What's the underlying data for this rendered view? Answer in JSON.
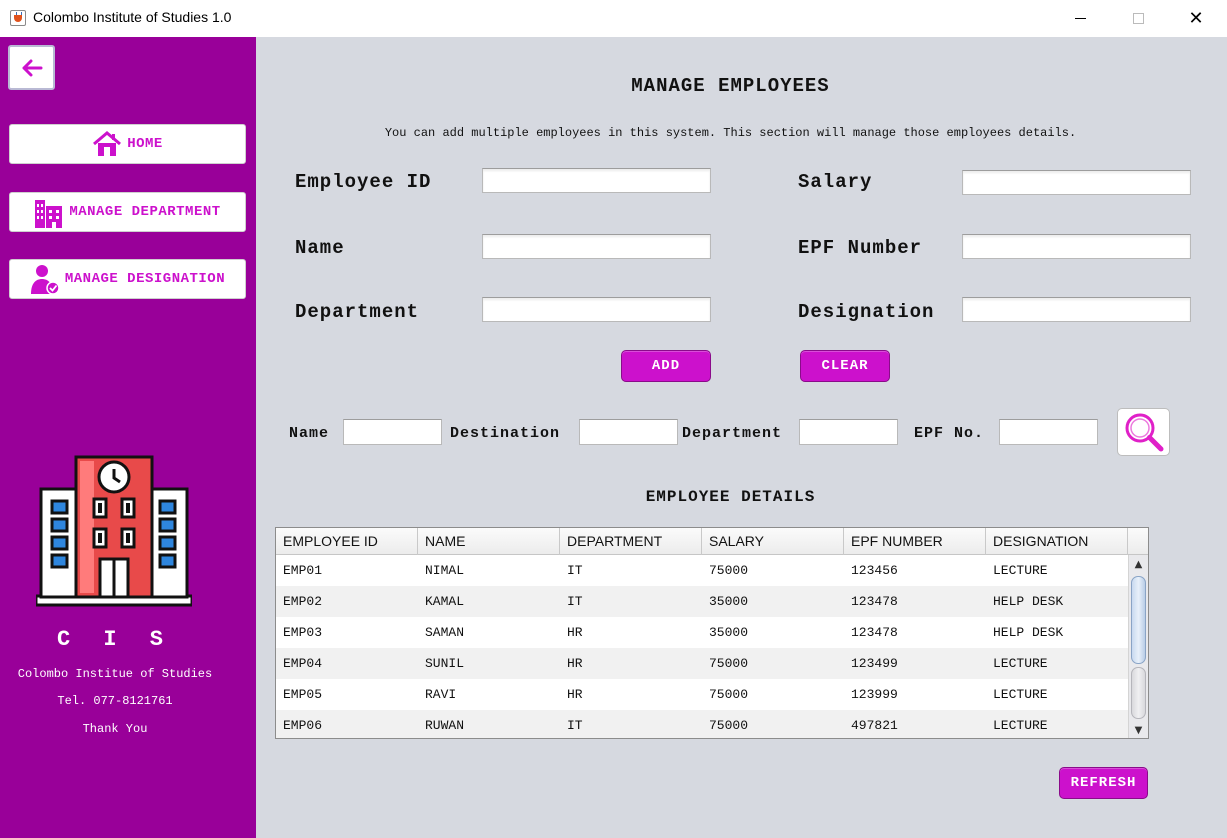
{
  "window": {
    "title": "Colombo Institute of Studies 1.0"
  },
  "sidebar": {
    "nav": [
      {
        "label": "HOME",
        "icon": "home-icon"
      },
      {
        "label": "MANAGE DEPARTMENT",
        "icon": "building-icon"
      },
      {
        "label": "MANAGE DESIGNATION",
        "icon": "user-check-icon"
      }
    ],
    "brand": {
      "abbr": "C I S",
      "name": "Colombo Institue of Studies",
      "tel": "Tel. 077-8121761",
      "thanks": "Thank You"
    }
  },
  "main": {
    "title": "MANAGE EMPLOYEES",
    "subtitle": "You can add multiple employees in this system. This section will manage those employees details.",
    "form": {
      "employee_id_label": "Employee ID",
      "name_label": "Name",
      "department_label": "Department",
      "salary_label": "Salary",
      "epf_label": "EPF Number",
      "designation_label": "Designation",
      "employee_id": "",
      "name": "",
      "department": "",
      "salary": "",
      "epf": "",
      "designation": ""
    },
    "buttons": {
      "add": "ADD",
      "clear": "CLEAR",
      "refresh": "REFRESH"
    },
    "search": {
      "name_label": "Name",
      "destination_label": "Destination",
      "department_label": "Department",
      "epf_label": "EPF No.",
      "name": "",
      "destination": "",
      "department": "",
      "epf": ""
    },
    "details_title": "EMPLOYEE DETAILS",
    "table": {
      "columns": [
        "EMPLOYEE ID",
        "NAME",
        "DEPARTMENT",
        "SALARY",
        "EPF NUMBER",
        "DESIGNATION"
      ],
      "rows": [
        [
          "EMP01",
          "NIMAL",
          "IT",
          "75000",
          "123456",
          "LECTURE"
        ],
        [
          "EMP02",
          "KAMAL",
          "IT",
          "35000",
          "123478",
          "HELP DESK"
        ],
        [
          "EMP03",
          "SAMAN",
          "HR",
          "35000",
          "123478",
          "HELP DESK"
        ],
        [
          "EMP04",
          "SUNIL",
          "HR",
          "75000",
          "123499",
          "LECTURE"
        ],
        [
          "EMP05",
          "RAVI",
          "HR",
          "75000",
          "123999",
          "LECTURE"
        ],
        [
          "EMP06",
          "RUWAN",
          "IT",
          "75000",
          "497821",
          "LECTURE"
        ]
      ]
    }
  },
  "colors": {
    "sidebar_bg": "#990099",
    "accent": "#cc11cc",
    "main_bg": "#d6d9e0"
  }
}
